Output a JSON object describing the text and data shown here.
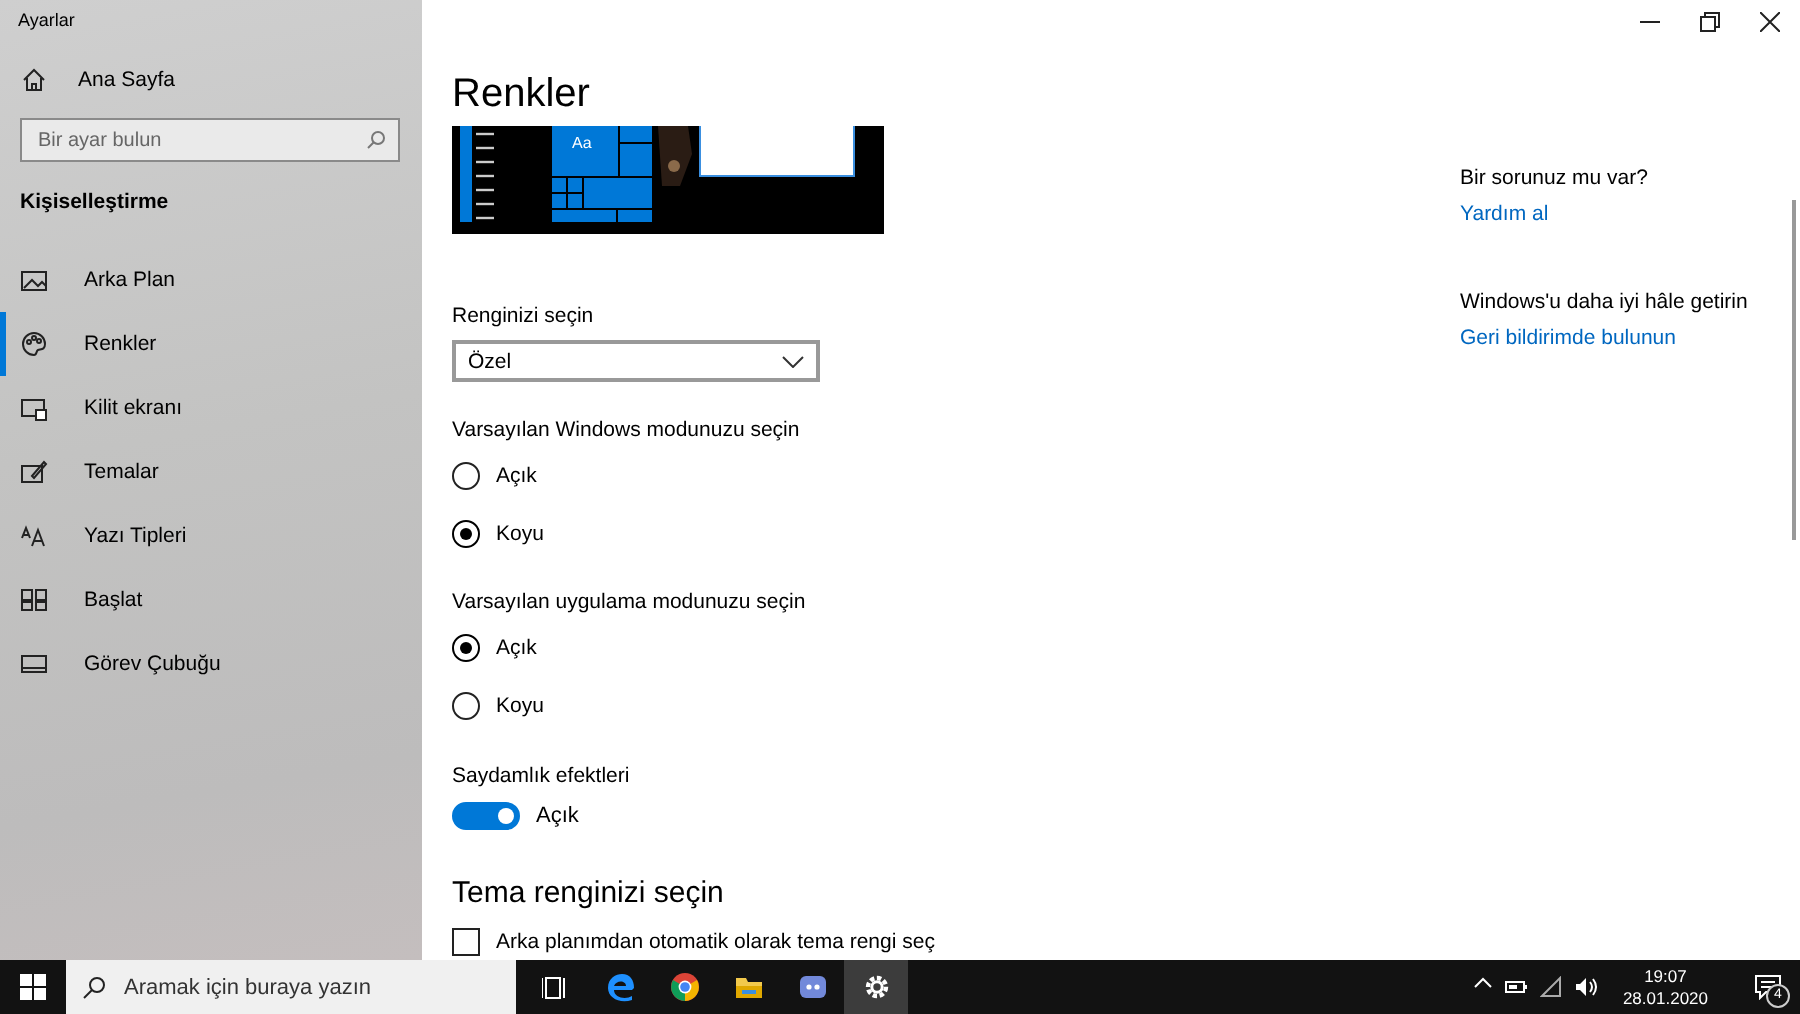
{
  "window": {
    "title": "Ayarlar"
  },
  "sidebar": {
    "home": "Ana Sayfa",
    "search": {
      "placeholder": "Bir ayar bulun"
    },
    "section": "Kişiselleştirme",
    "items": [
      {
        "label": "Arka Plan",
        "selected": false
      },
      {
        "label": "Renkler",
        "selected": true
      },
      {
        "label": "Kilit ekranı",
        "selected": false
      },
      {
        "label": "Temalar",
        "selected": false
      },
      {
        "label": "Yazı Tipleri",
        "selected": false
      },
      {
        "label": "Başlat",
        "selected": false
      },
      {
        "label": "Görev Çubuğu",
        "selected": false
      }
    ]
  },
  "main": {
    "title": "Renkler",
    "preview": {
      "sample": "Aa"
    },
    "color_select": {
      "label": "Renginizi seçin",
      "value": "Özel"
    },
    "groups": [
      {
        "kind": "radio",
        "label": "Varsayılan Windows modunuzu seçin",
        "options": [
          {
            "label": "Açık",
            "selected": false
          },
          {
            "label": "Koyu",
            "selected": true
          }
        ]
      },
      {
        "kind": "radio",
        "label": "Varsayılan uygulama modunuzu seçin",
        "options": [
          {
            "label": "Açık",
            "selected": true
          },
          {
            "label": "Koyu",
            "selected": false
          }
        ]
      },
      {
        "kind": "toggle",
        "label": "Saydamlık efektleri",
        "on": true,
        "state_text": "Açık"
      }
    ],
    "theme_heading": "Tema renginizi seçin",
    "auto_accent": {
      "label": "Arka planımdan otomatik olarak tema rengi seç",
      "checked": false
    }
  },
  "help": [
    {
      "heading": "Bir sorunuz mu var?",
      "link": "Yardım al"
    },
    {
      "heading": "Windows'u daha iyi hâle getirin",
      "link": "Geri bildirimde bulunun"
    }
  ],
  "taskbar": {
    "search": {
      "placeholder": "Aramak için buraya yazın"
    },
    "apps": [
      {
        "selected": false
      },
      {
        "selected": false
      },
      {
        "selected": false
      },
      {
        "selected": false
      },
      {
        "selected": false
      },
      {
        "selected": true
      }
    ],
    "time": "19:07",
    "date": "28.01.2020",
    "notifications": "4"
  }
}
